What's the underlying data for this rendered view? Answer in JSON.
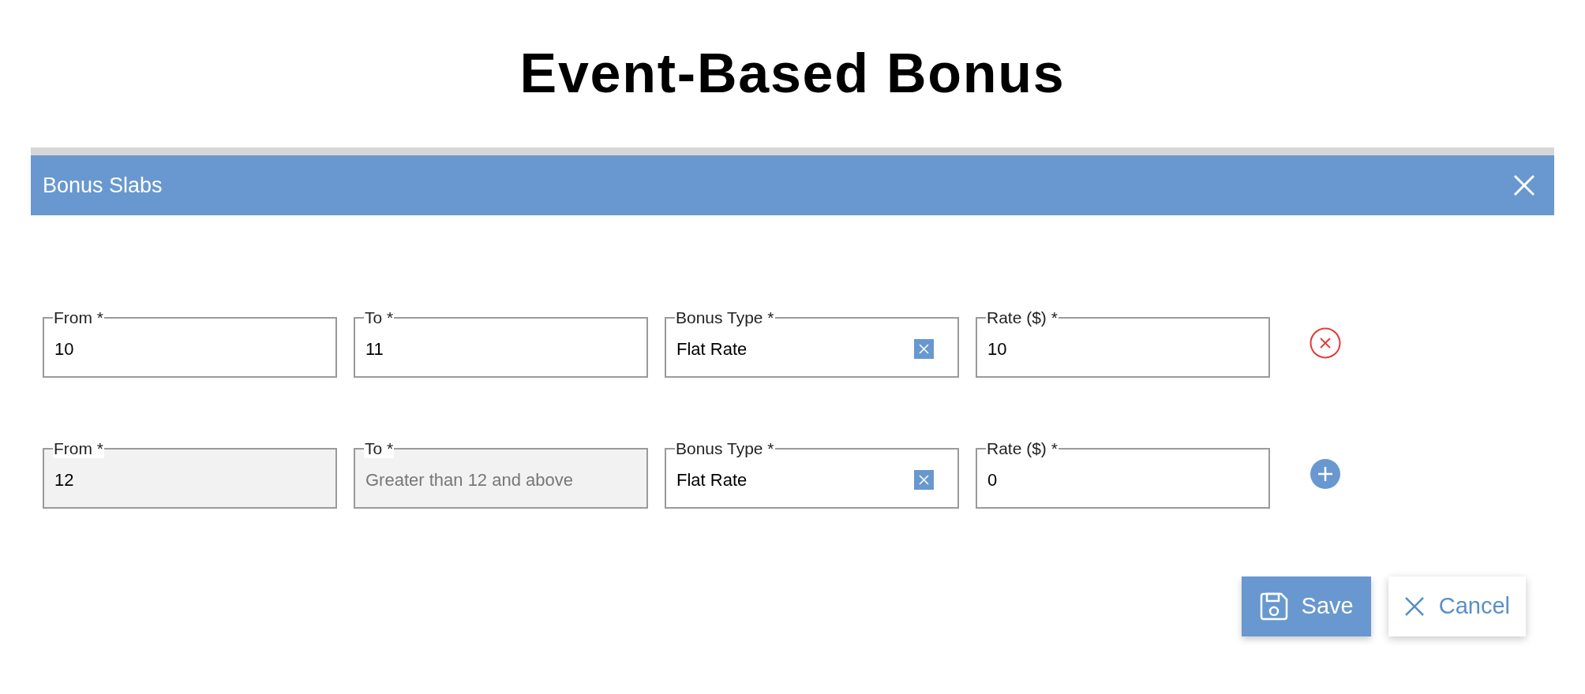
{
  "page_title": "Event-Based Bonus",
  "dialog": {
    "title": "Bonus Slabs",
    "rows": [
      {
        "fields": [
          {
            "kind": "text",
            "label": "From *",
            "value": "10",
            "disabled": false
          },
          {
            "kind": "text",
            "label": "To *",
            "value": "11",
            "disabled": false
          },
          {
            "kind": "select",
            "label": "Bonus Type *",
            "value": "Flat Rate",
            "disabled": false
          },
          {
            "kind": "text",
            "label": "Rate ($) *",
            "value": "10",
            "disabled": false
          }
        ],
        "action": {
          "kind": "remove"
        }
      },
      {
        "fields": [
          {
            "kind": "text",
            "label": "From *",
            "value": "12",
            "disabled": true
          },
          {
            "kind": "text",
            "label": "To *",
            "placeholder": "Greater than 12 and above",
            "disabled": true
          },
          {
            "kind": "select",
            "label": "Bonus Type *",
            "value": "Flat Rate",
            "disabled": false
          },
          {
            "kind": "text",
            "label": "Rate ($) *",
            "value": "0",
            "disabled": false
          }
        ],
        "action": {
          "kind": "add"
        }
      }
    ],
    "buttons": [
      {
        "kind": "save",
        "label": "Save"
      },
      {
        "kind": "cancel",
        "label": "Cancel"
      }
    ]
  }
}
